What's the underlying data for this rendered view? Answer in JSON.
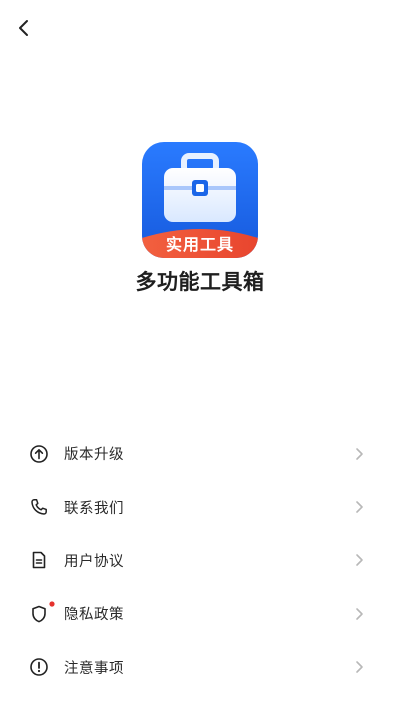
{
  "app": {
    "name": "多功能工具箱",
    "icon_banner": "实用工具"
  },
  "menu": {
    "items": [
      {
        "label": "版本升级",
        "icon": "upgrade-arrow-icon"
      },
      {
        "label": "联系我们",
        "icon": "phone-icon"
      },
      {
        "label": "用户协议",
        "icon": "document-icon"
      },
      {
        "label": "隐私政策",
        "icon": "shield-icon",
        "badge": true
      },
      {
        "label": "注意事项",
        "icon": "exclamation-circle-icon"
      }
    ]
  },
  "colors": {
    "icon_blue": "#1f6cf0",
    "icon_banner_red": "#f0523a",
    "badge_red": "#e5322d",
    "chevron_gray": "#b8b8b8"
  }
}
